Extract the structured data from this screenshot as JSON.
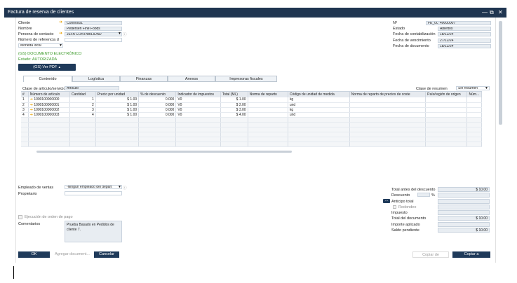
{
  "window": {
    "title": "Factura de reserva de clientes"
  },
  "header_left": {
    "cliente_label": "Cliente",
    "cliente_value": "C0000001",
    "nombre_label": "Nombre",
    "nombre_value": "Pedersen Fine Foods",
    "contacto_label": "Persona de contacto",
    "contacto_value": "JEFA CONTABILIDAD",
    "referencia_label": "Número de referencia d",
    "moneda_label": "Moneda local",
    "documento_electronico": "(GS) DOCUMENTO ELECTRÓNICO",
    "estado_doc": "Estado: AUTORIZADA",
    "ver_pdf": "(GS) Ver PDF"
  },
  "header_right": {
    "no_label": "Nº",
    "no_series": "FE_001",
    "no_value": "40000007",
    "estado_label": "Estado",
    "estado_value": "Abiertos",
    "fcontab_label": "Fecha de contabilización",
    "fcontab_value": "18/12/24",
    "fvenc_label": "Fecha de vencimiento",
    "fvenc_value": "27/12/24",
    "fdoc_label": "Fecha de documento",
    "fdoc_value": "18/12/24"
  },
  "tabs": [
    "Contenido",
    "Logística",
    "Finanzas",
    "Anexos",
    "Impresoras fiscales"
  ],
  "content": {
    "clase_articulo_label": "Clase de artículo/servicio",
    "clase_articulo_value": "Artículo",
    "clase_resumen_label": "Clase de resumen",
    "clase_resumen_value": "Sin resumen"
  },
  "table": {
    "columns": [
      "#",
      "Número de artículo",
      "Cantidad",
      "Precio por unidad",
      "% de descuento",
      "Indicador de impuestos",
      "Total (ML)",
      "Norma de reparto",
      "Código de unidad de medida",
      "Norma de reparto de precios de coste",
      "País/región de origen",
      "Núm..."
    ],
    "rows": [
      [
        "1",
        "1000100000000",
        "1",
        "$ 1.00",
        "0.000",
        "V0",
        "$ 1.00",
        "",
        "kg",
        "",
        "",
        ""
      ],
      [
        "2",
        "1000100000001",
        "2",
        "$ 1.00",
        "0.000",
        "V0",
        "$ 2.00",
        "",
        "und",
        "",
        "",
        ""
      ],
      [
        "3",
        "1000100000002",
        "3",
        "$ 1.00",
        "0.000",
        "V0",
        "$ 3.00",
        "",
        "kg",
        "",
        "",
        ""
      ],
      [
        "4",
        "1000100000003",
        "4",
        "$ 1.00",
        "0.000",
        "V0",
        "$ 4.00",
        "",
        "und",
        "",
        "",
        ""
      ]
    ]
  },
  "footer_left": {
    "empleado_label": "Empleado de ventas",
    "empleado_value": "-Ningún empleado del depart",
    "propietario_label": "Propietario",
    "ejecucion_label": "Ejecución de orden de pago",
    "comentarios_label": "Comentarios",
    "comentarios_value": "Prueba Basado en Pedidos de cliente 7."
  },
  "totals": {
    "total_antes_label": "Total antes del descuento",
    "total_antes_value": "$ 10.00",
    "descuento_label": "Descuento",
    "pct": "%",
    "anticipo_label": "Anticipo total",
    "redondeo_label": "Redondeo",
    "impuesto_label": "Impuesto",
    "total_doc_label": "Total del documento",
    "total_doc_value": "$ 10.00",
    "importe_aplicado_label": "Importe aplicado",
    "saldo_label": "Saldo pendiente",
    "saldo_value": "$ 10.00"
  },
  "buttons": {
    "ok": "OK",
    "agregar": "Agregar document...",
    "cancelar": "Cancelar",
    "copiar_de": "Copiar de",
    "copiar_a": "Copiar a"
  },
  "colors": {
    "titlebar": "#1f3550",
    "button": "#1f3a5a",
    "accent_arrow": "#e8a200",
    "status_green": "#3c9a2a"
  }
}
